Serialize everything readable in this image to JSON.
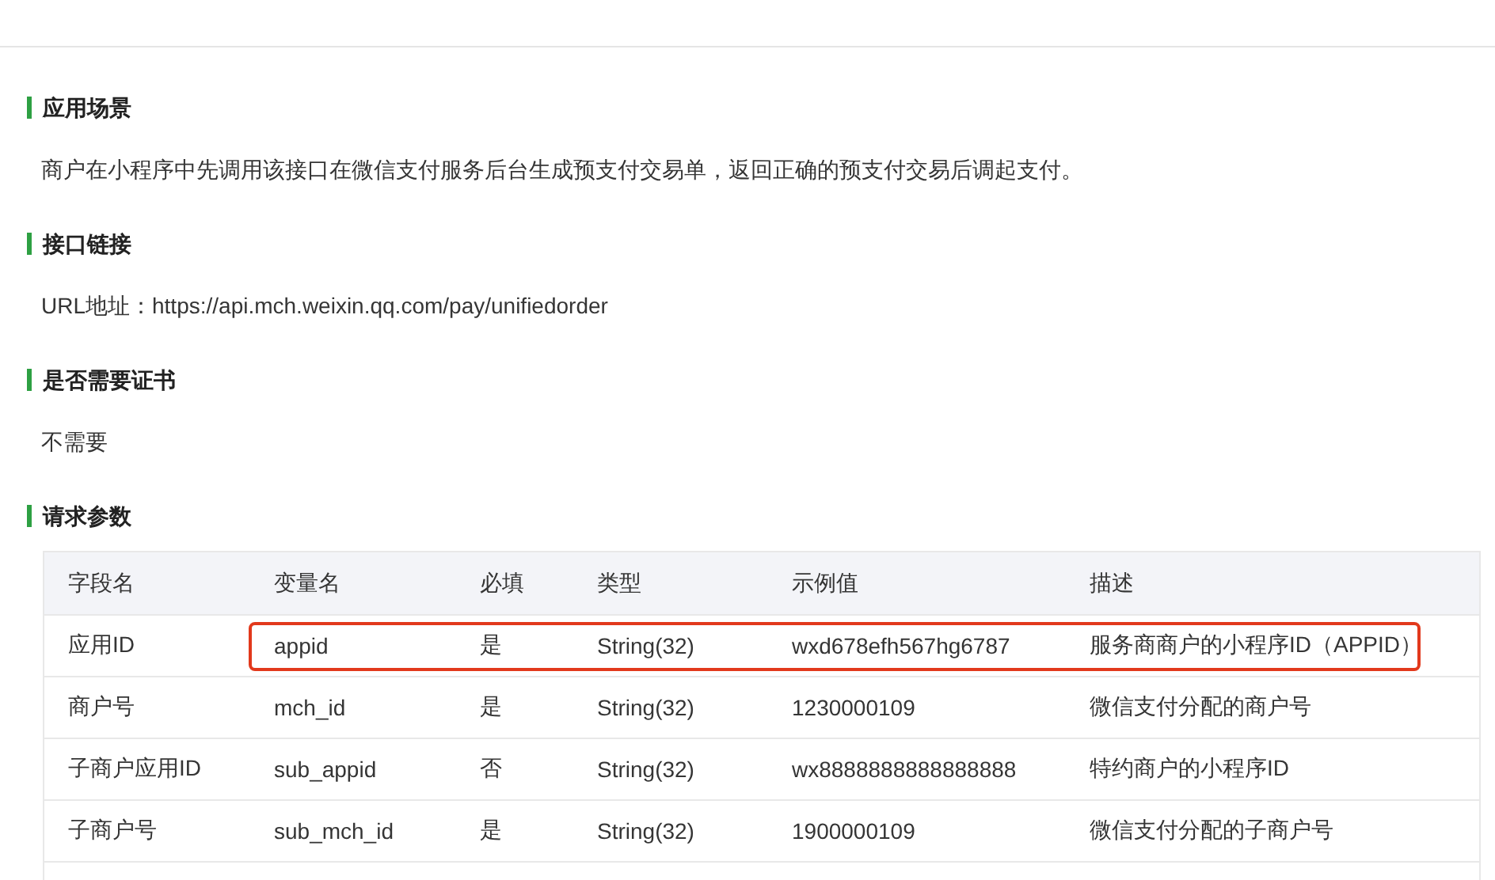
{
  "sections": [
    {
      "heading": "应用场景",
      "text": "商户在小程序中先调用该接口在微信支付服务后台生成预支付交易单，返回正确的预支付交易后调起支付。"
    },
    {
      "heading": "接口链接",
      "text": "URL地址：https://api.mch.weixin.qq.com/pay/unifiedorder"
    },
    {
      "heading": "是否需要证书",
      "text": "不需要"
    },
    {
      "heading": "请求参数"
    }
  ],
  "table": {
    "columns": [
      "字段名",
      "变量名",
      "必填",
      "类型",
      "示例值",
      "描述"
    ],
    "rows": [
      {
        "cells": [
          "应用ID",
          "appid",
          "是",
          "String(32)",
          "wxd678efh567hg6787",
          "服务商商户的小程序ID（APPID）"
        ],
        "highlighted": true
      },
      {
        "cells": [
          "商户号",
          "mch_id",
          "是",
          "String(32)",
          "1230000109",
          "微信支付分配的商户号"
        ],
        "highlighted": false
      },
      {
        "cells": [
          "子商户应用ID",
          "sub_appid",
          "否",
          "String(32)",
          "wx8888888888888888",
          "特约商户的小程序ID"
        ],
        "highlighted": false
      },
      {
        "cells": [
          "子商户号",
          "sub_mch_id",
          "是",
          "String(32)",
          "1900000109",
          "微信支付分配的子商户号"
        ],
        "highlighted": false
      }
    ]
  }
}
